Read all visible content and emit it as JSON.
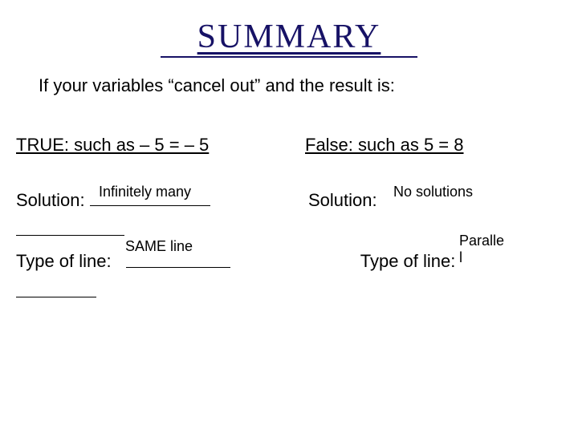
{
  "title": "SUMMARY",
  "intro": "If your variables “cancel out” and the result is:",
  "left": {
    "case_head": "TRUE:  such as – 5 = – 5",
    "solution_label": "Solution:",
    "solution_answer": "Infinitely many",
    "type_label": "Type of line:",
    "type_answer": "SAME line"
  },
  "right": {
    "case_head": "False:  such as 5 = 8",
    "solution_label": "Solution:",
    "solution_answer": "No solutions",
    "type_label": "Type of line:",
    "type_answer": "Paralle\nl"
  }
}
